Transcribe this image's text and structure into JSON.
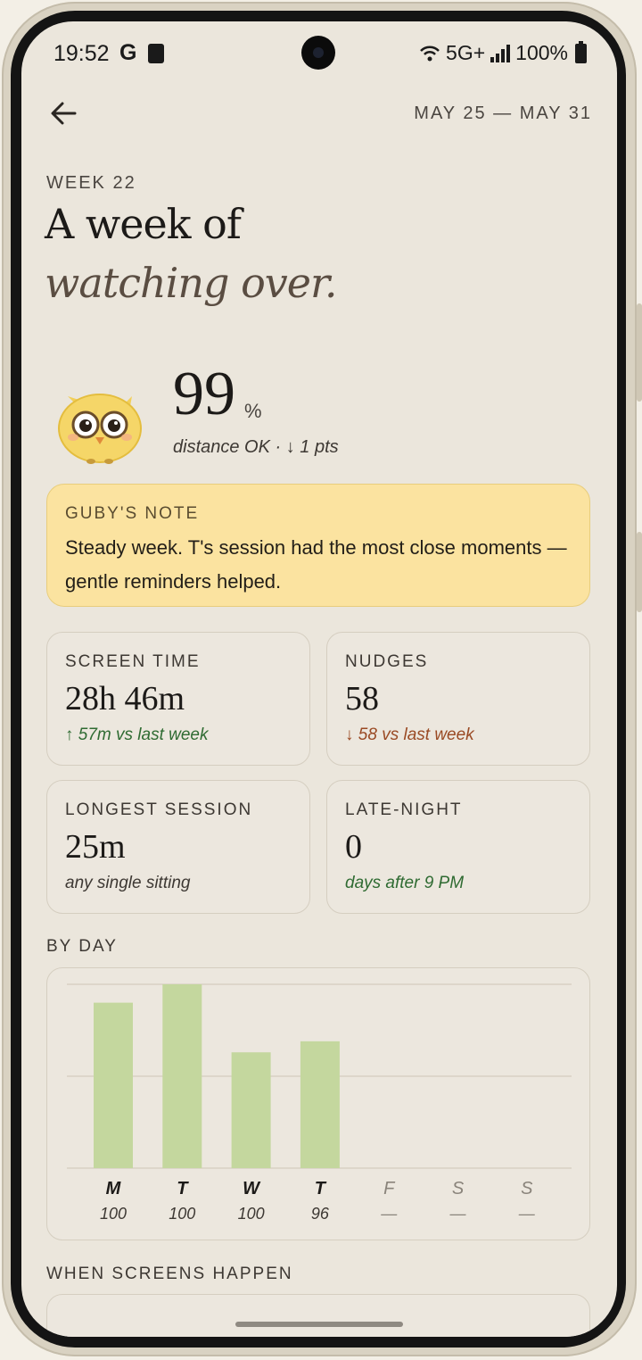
{
  "status_bar": {
    "time": "19:52",
    "network": "5G+",
    "battery": "100%"
  },
  "header": {
    "date_range": "MAY 25 — MAY 31",
    "week_label": "WEEK 22",
    "title_line1": "A week of",
    "title_line2": "watching over."
  },
  "score": {
    "value": "99",
    "unit": "%",
    "subtitle": "distance OK · ↓ 1 pts"
  },
  "note": {
    "label": "GUBY'S NOTE",
    "text": "Steady week. T's session had the most close moments — gentle reminders helped."
  },
  "stats": [
    {
      "label": "SCREEN TIME",
      "value": "28h 46m",
      "sub": "↑ 57m vs last week",
      "tone": "green"
    },
    {
      "label": "NUDGES",
      "value": "58",
      "sub": "↓ 58 vs last week",
      "tone": "rust"
    },
    {
      "label": "LONGEST SESSION",
      "value": "25m",
      "sub": "any single sitting",
      "tone": "plain"
    },
    {
      "label": "LATE-NIGHT",
      "value": "0",
      "sub": "days after 9 PM",
      "tone": "green"
    }
  ],
  "by_day_label": "BY DAY",
  "when_label": "WHEN SCREENS HAPPEN",
  "colors": {
    "bar": "#c4d79e",
    "note_bg": "#fbe3a0",
    "green": "#2f6b32",
    "rust": "#9a4a24"
  },
  "chart_data": {
    "type": "bar",
    "categories": [
      "M",
      "T",
      "W",
      "T",
      "F",
      "S",
      "S"
    ],
    "value_labels": [
      "100",
      "100",
      "100",
      "96",
      "—",
      "—",
      "—"
    ],
    "bar_heights_relative": [
      0.9,
      1.0,
      0.63,
      0.69,
      null,
      null,
      null
    ],
    "grid": true
  }
}
